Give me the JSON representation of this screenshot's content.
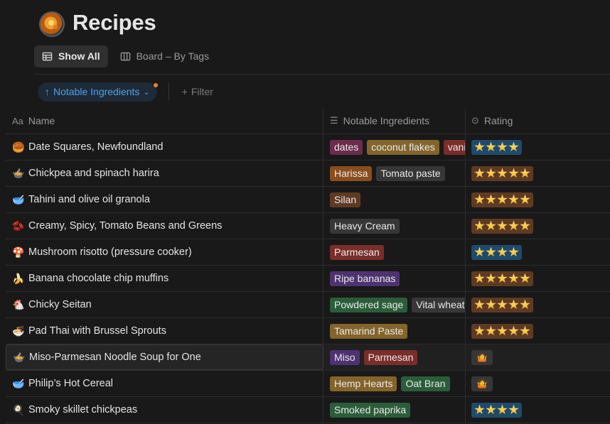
{
  "page": {
    "title": "Recipes",
    "icon": "pizza-pan-icon"
  },
  "views": [
    {
      "label": "Show All",
      "icon": "table-icon",
      "active": true
    },
    {
      "label": "Board – By Tags",
      "icon": "board-icon",
      "active": false
    }
  ],
  "toolbar": {
    "sort_label": "Notable Ingredients",
    "filter_label": "Filter"
  },
  "columns": {
    "name": "Name",
    "ingredients": "Notable Ingredients",
    "rating": "Rating"
  },
  "colors": {
    "accent": "#4ea3e8",
    "sort_dot": "#e8832a",
    "tag_pink": "#6c2c4b",
    "tag_yellow": "#83642b",
    "tag_orange": "#8a4d1c",
    "tag_gray": "#373737",
    "tag_red": "#7a2e2a",
    "tag_purple": "#4f3270",
    "tag_green": "#2b5d3a",
    "rating_blue": "#1f4a6b",
    "rating_brown": "#5f3a22"
  },
  "rows": [
    {
      "emoji": "🥮",
      "name": "Date Squares, Newfoundland",
      "tags": [
        {
          "text": "dates",
          "color": "#6c2c4b"
        },
        {
          "text": "coconut flakes",
          "color": "#83642b"
        },
        {
          "text": "vanilla",
          "color": "#7a2e2a"
        }
      ],
      "rating": {
        "type": "stars",
        "count": 4,
        "color": "#1f4a6b"
      }
    },
    {
      "emoji": "🍲",
      "name": "Chickpea and spinach harira",
      "tags": [
        {
          "text": "Harissa",
          "color": "#8a4d1c"
        },
        {
          "text": "Tomato paste",
          "color": "#373737"
        }
      ],
      "rating": {
        "type": "stars",
        "count": 5,
        "color": "#5f3a22"
      }
    },
    {
      "emoji": "🥣",
      "name": "Tahini and olive oil granola",
      "tags": [
        {
          "text": "Silan",
          "color": "#5f3a22"
        }
      ],
      "rating": {
        "type": "stars",
        "count": 5,
        "color": "#5f3a22"
      }
    },
    {
      "emoji": "🫘",
      "name": "Creamy, Spicy, Tomato Beans and Greens",
      "tags": [
        {
          "text": "Heavy Cream",
          "color": "#373737"
        }
      ],
      "rating": {
        "type": "stars",
        "count": 5,
        "color": "#5f3a22"
      }
    },
    {
      "emoji": "🍄",
      "name": "Mushroom risotto (pressure cooker)",
      "tags": [
        {
          "text": "Parmesan",
          "color": "#7a2e2a"
        }
      ],
      "rating": {
        "type": "stars",
        "count": 4,
        "color": "#1f4a6b"
      }
    },
    {
      "emoji": "🍌",
      "name": "Banana chocolate chip muffins",
      "tags": [
        {
          "text": "Ripe bananas",
          "color": "#4f3270"
        }
      ],
      "rating": {
        "type": "stars",
        "count": 5,
        "color": "#5f3a22"
      }
    },
    {
      "emoji": "🐔",
      "name": "Chicky Seitan",
      "tags": [
        {
          "text": "Powdered sage",
          "color": "#2b5d3a"
        },
        {
          "text": "Vital wheat gluten",
          "color": "#373737"
        }
      ],
      "rating": {
        "type": "stars",
        "count": 5,
        "color": "#5f3a22"
      }
    },
    {
      "emoji": "🍜",
      "name": "Pad Thai with Brussel Sprouts",
      "tags": [
        {
          "text": "Tamarind Paste",
          "color": "#83642b"
        }
      ],
      "rating": {
        "type": "stars",
        "count": 5,
        "color": "#5f3a22"
      }
    },
    {
      "emoji": "🍲",
      "name": "Miso-Parmesan Noodle Soup for One",
      "tags": [
        {
          "text": "Miso",
          "color": "#4f3270"
        },
        {
          "text": "Parmesan",
          "color": "#7a2e2a"
        }
      ],
      "rating": {
        "type": "shrug",
        "emoji": "🤷"
      },
      "hover": true
    },
    {
      "emoji": "🥣",
      "name": "Philip’s Hot Cereal",
      "tags": [
        {
          "text": "Hemp Hearts",
          "color": "#83642b"
        },
        {
          "text": "Oat Bran",
          "color": "#2b5d3a"
        }
      ],
      "rating": {
        "type": "shrug",
        "emoji": "🤷"
      }
    },
    {
      "emoji": "🍳",
      "name": "Smoky skillet chickpeas",
      "tags": [
        {
          "text": "Smoked paprika",
          "color": "#2b5d3a"
        }
      ],
      "rating": {
        "type": "stars",
        "count": 4,
        "color": "#1f4a6b"
      }
    }
  ]
}
